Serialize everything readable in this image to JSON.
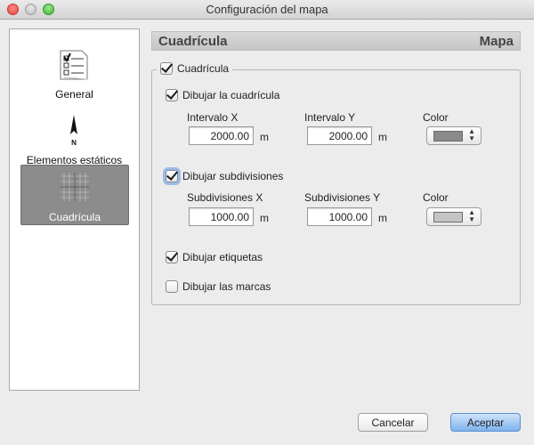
{
  "window": {
    "title": "Configuración del mapa"
  },
  "sidebar": {
    "items": [
      {
        "label": "General",
        "icon": "checklist-icon"
      },
      {
        "label": "Elementos estáticos",
        "icon": "north-arrow-icon"
      },
      {
        "label": "Cuadrícula",
        "icon": "grid-icon",
        "selected": true
      }
    ]
  },
  "header": {
    "title": "Cuadrícula",
    "right": "Mapa"
  },
  "group": {
    "label": "Cuadrícula",
    "checked": true
  },
  "grid": {
    "draw_label": "Dibujar la cuadrícula",
    "checked": true,
    "interval_x_label": "Intervalo X",
    "interval_y_label": "Intervalo Y",
    "color_label": "Color",
    "interval_x": "2000.00",
    "interval_y": "2000.00",
    "unit_x": "m",
    "unit_y": "m",
    "color": "#8a8a8a"
  },
  "subdivisions": {
    "draw_label": "Dibujar subdivisiones",
    "checked": true,
    "x_label": "Subdivisiones X",
    "y_label": "Subdivisiones Y",
    "color_label": "Color",
    "x": "1000.00",
    "y": "1000.00",
    "unit_x": "m",
    "unit_y": "m",
    "color": "#c4c4c4"
  },
  "labels": {
    "draw_label": "Dibujar etiquetas",
    "checked": true
  },
  "marks": {
    "draw_label": "Dibujar las marcas",
    "checked": false
  },
  "buttons": {
    "cancel": "Cancelar",
    "accept": "Aceptar"
  }
}
